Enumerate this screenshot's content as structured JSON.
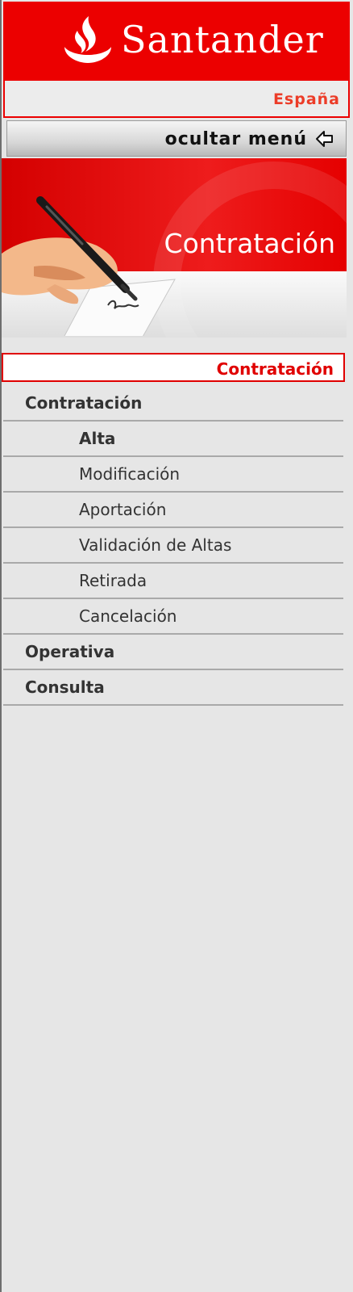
{
  "brand": {
    "name": "Santander",
    "logo_icon": "flame-icon",
    "color": "#ec0000"
  },
  "country": "España",
  "toggle": {
    "label": "ocultar menú",
    "icon": "arrow-left-icon"
  },
  "banner": {
    "title": "Contratación",
    "illustration": "hand-signing-document-icon"
  },
  "section": {
    "title": "Contratación"
  },
  "menu": {
    "items": [
      {
        "label": "Contratación",
        "level": 1
      },
      {
        "label": "Alta",
        "level": 2,
        "active": true
      },
      {
        "label": "Modificación",
        "level": 2
      },
      {
        "label": "Aportación",
        "level": 2
      },
      {
        "label": "Validación de Altas",
        "level": 2
      },
      {
        "label": "Retirada",
        "level": 2
      },
      {
        "label": "Cancelación",
        "level": 2
      },
      {
        "label": "Operativa",
        "level": 1
      },
      {
        "label": "Consulta",
        "level": 1
      }
    ]
  }
}
